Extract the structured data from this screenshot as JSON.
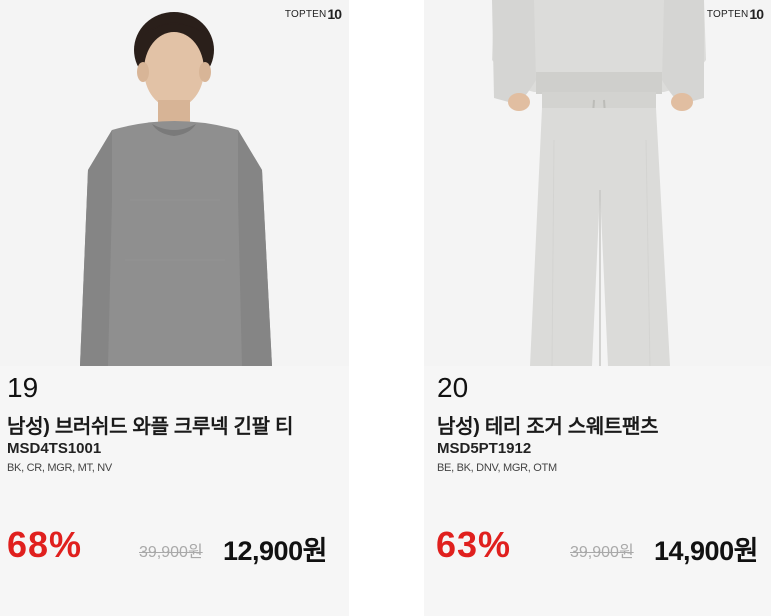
{
  "brand": {
    "logo_text": "TOPTEN",
    "logo_number": "10"
  },
  "products": [
    {
      "rank": "19",
      "name": "남성) 브러쉬드 와플 크루넥 긴팔 티",
      "code": "MSD4TS1001",
      "colors": "BK, CR, MGR, MT, NV",
      "discount": "68%",
      "original_price": "39,900원",
      "sale_price": "12,900원",
      "image": "man-gray-crewneck-long-sleeve-tee"
    },
    {
      "rank": "20",
      "name": "남성) 테리 조거 스웨트팬츠",
      "code": "MSD5PT1912",
      "colors": "BE, BK, DNV, MGR, OTM",
      "discount": "63%",
      "original_price": "39,900원",
      "sale_price": "14,900원",
      "image": "light-gray-terry-jogger-sweatpants"
    }
  ],
  "colors": {
    "discount": "#e0201e",
    "original_price": "#a9a9a9",
    "info_background": "#f6f6f6",
    "image_background": "#f4f4f4"
  }
}
